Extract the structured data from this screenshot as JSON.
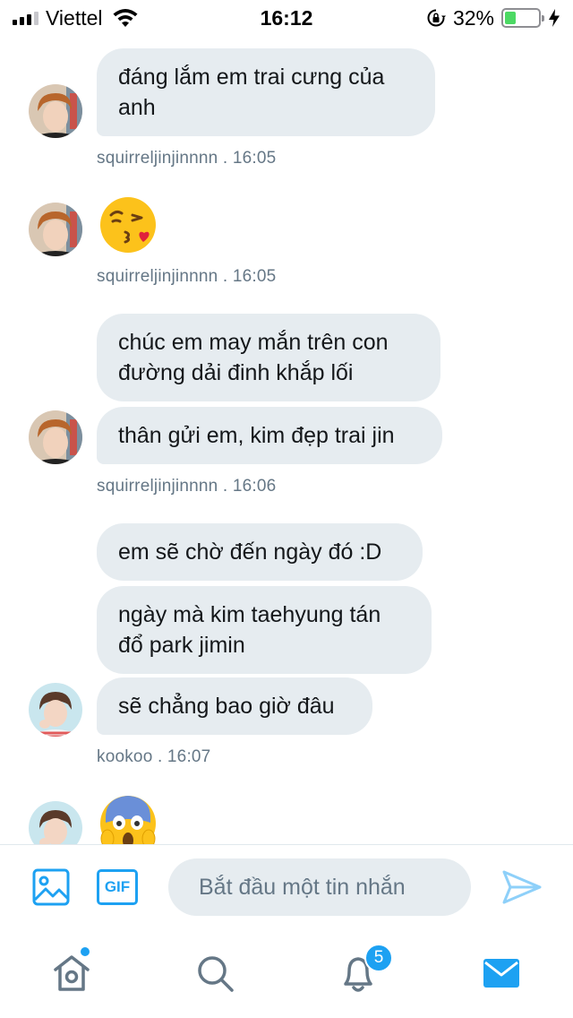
{
  "status_bar": {
    "carrier": "Viettel",
    "time": "16:12",
    "battery_percent": "32%",
    "battery_level": 0.32,
    "icons": [
      "signal-icon",
      "wifi-icon",
      "rotation-lock-icon",
      "battery-icon",
      "charging-bolt-icon"
    ]
  },
  "messages": [
    {
      "sender": "squirreljinjinnnn",
      "type": "text",
      "text": "đáng lắm em trai cưng của anh"
    },
    {
      "sender": "squirreljinjinnnn",
      "meta": "squirreljinjinnnn  . 16:05"
    },
    {
      "sender": "squirreljinjinnnn",
      "type": "emoji",
      "emoji": "face-blowing-kiss"
    },
    {
      "sender": "squirreljinjinnnn",
      "meta": "squirreljinjinnnn  . 16:05"
    },
    {
      "sender": "squirreljinjinnnn",
      "type": "text",
      "text": "chúc em may mắn trên con đường dải đinh khắp lối"
    },
    {
      "sender": "squirreljinjinnnn",
      "type": "text",
      "text": "thân gửi em, kim đẹp trai jin"
    },
    {
      "sender": "squirreljinjinnnn",
      "meta": "squirreljinjinnnn  . 16:06"
    },
    {
      "sender": "kookoo",
      "type": "text",
      "text": "em sẽ chờ đến ngày đó :D"
    },
    {
      "sender": "kookoo",
      "type": "text",
      "text": "ngày mà kim taehyung tán đổ park jimin"
    },
    {
      "sender": "kookoo",
      "type": "text",
      "text": "sẽ chẳng bao giờ đâu"
    },
    {
      "sender": "kookoo",
      "meta": "kookoo  . 16:07"
    },
    {
      "sender": "kookoo",
      "type": "emoji",
      "emoji": "face-screaming-in-fear"
    }
  ],
  "composer": {
    "placeholder": "Bắt đầu một tin nhắn",
    "gif_label": "GIF",
    "icons": [
      "image-icon",
      "gif-icon",
      "send-icon"
    ]
  },
  "tabbar": {
    "tabs": [
      "home-icon",
      "search-icon",
      "notifications-icon",
      "messages-icon"
    ],
    "notifications_badge": "5",
    "accent": "#1da1f2"
  },
  "colors": {
    "bubble": "#e6ecf0",
    "meta_text": "#657786",
    "accent": "#1da1f2"
  }
}
